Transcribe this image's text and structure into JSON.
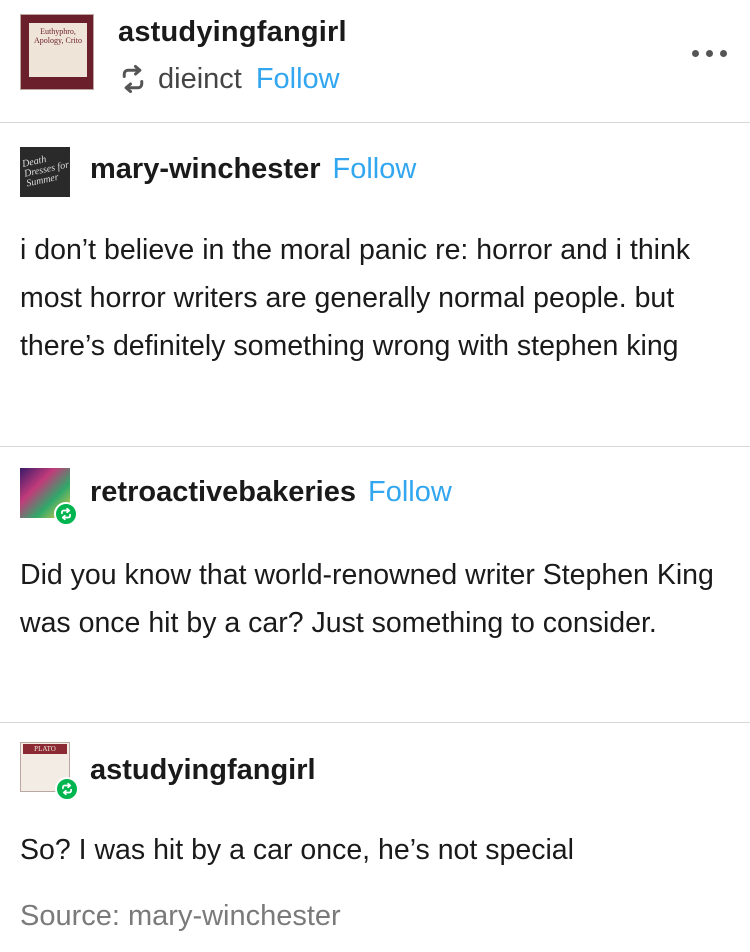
{
  "header": {
    "avatar_text": "Euthyphro, Apology, Crito",
    "username": "astudyingfangirl",
    "reblogged_from": "dieinct",
    "follow_label": "Follow"
  },
  "posts": [
    {
      "username": "mary-winchester",
      "follow_label": "Follow",
      "avatar_text": "Death Dresses for Summer",
      "body": "i don’t believe in the moral panic re: horror and i think most horror writers are generally normal people. but there’s definitely something wrong with stephen king"
    },
    {
      "username": "retroactivebakeries",
      "follow_label": "Follow",
      "body": "Did you know that world-renowned writer Stephen King was once hit by a car? Just something to consider."
    },
    {
      "username": "astudyingfangirl",
      "avatar_text": "PLATO",
      "body": "So? I was hit by a car once, he’s not special"
    }
  ],
  "footer": {
    "source": "Source: mary-winchester"
  },
  "colors": {
    "follow": "#32a6ef",
    "reblog_badge": "#00b54f",
    "divider": "#d7d7d7",
    "source_text": "#7a7a7a"
  },
  "icons": [
    "reblog-icon",
    "more-options-icon"
  ]
}
